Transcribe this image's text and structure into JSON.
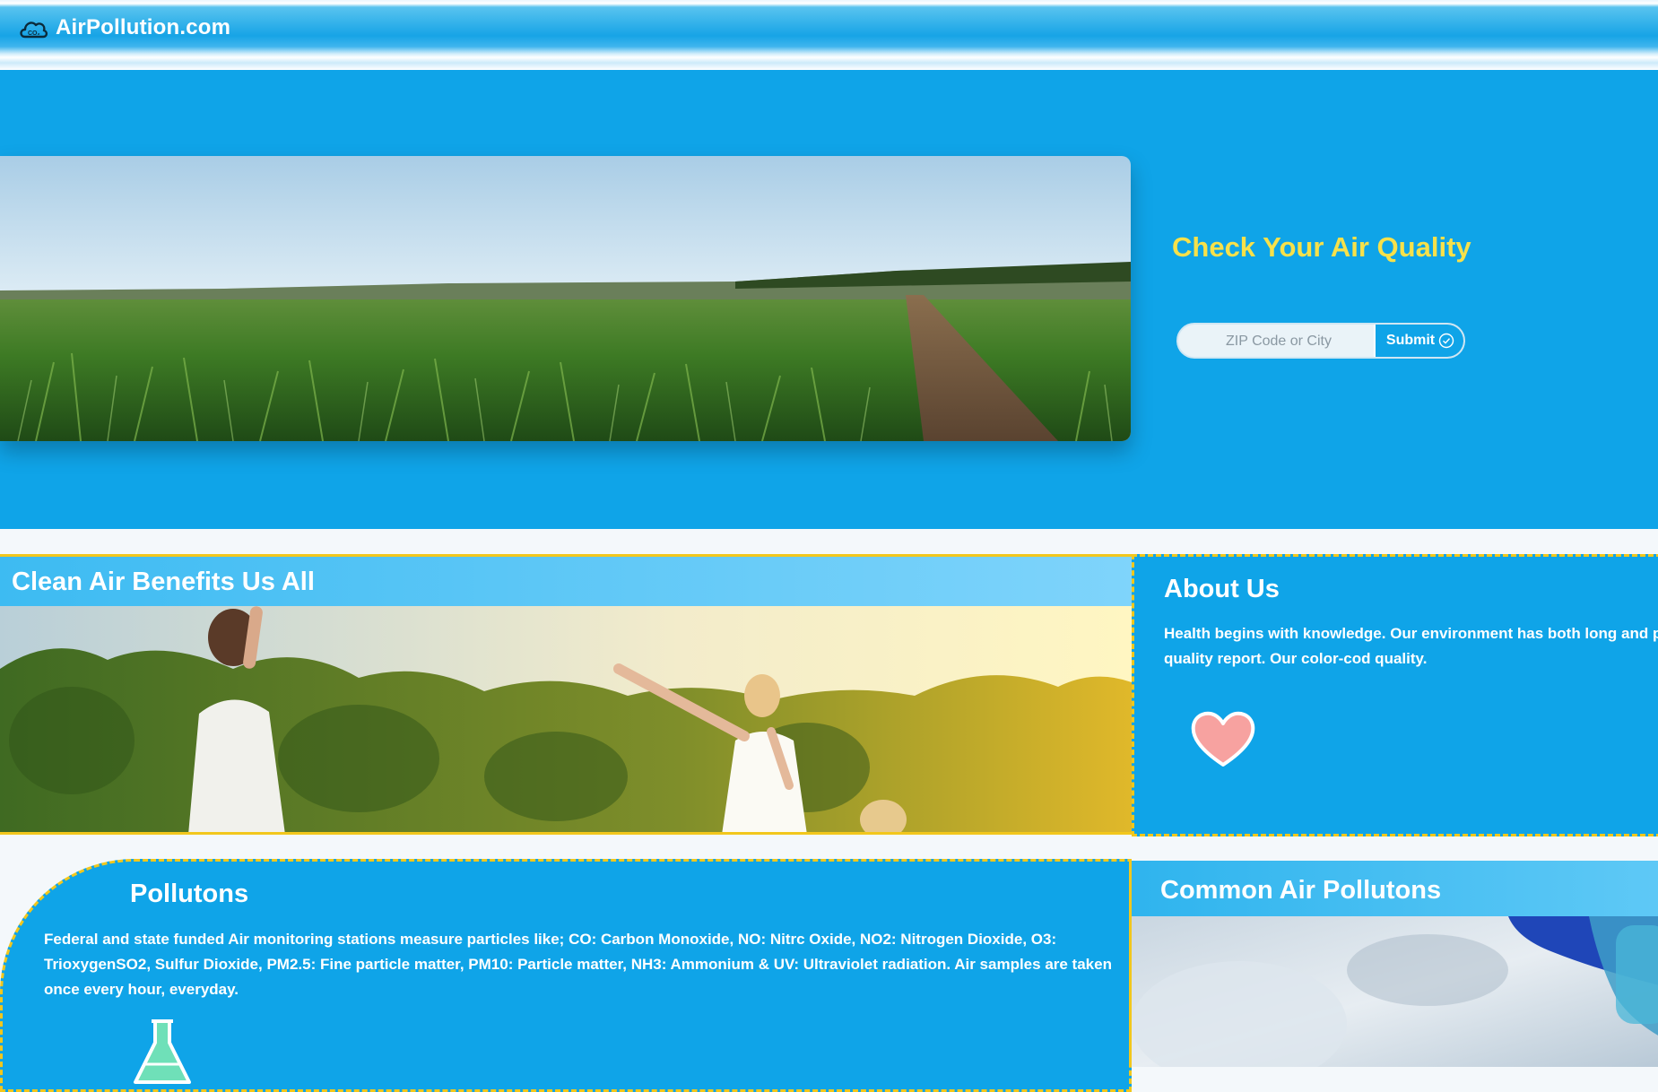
{
  "header": {
    "brand": "AirPollution.com",
    "logo_icon": "co2-cloud-icon"
  },
  "hero": {
    "title": "Check Your Air Quality",
    "search_placeholder": "ZIP Code or City",
    "submit_label": "Submit",
    "title_color": "#f7e14a",
    "background": "#0fa4e8"
  },
  "clean_air": {
    "title": "Clean Air Benefits Us All"
  },
  "about": {
    "title": "About Us",
    "text": "Health begins with knowledge. Our environment has both long and provide an instant and accurate live air quality report. Our color-cod quality.",
    "icon": "heart-icon"
  },
  "pollutants": {
    "title": "Pollutons",
    "text": "Federal and state funded Air monitoring stations measure particles like; CO: Carbon Monoxide, NO: Nitrc Oxide, NO2: Nitrogen Dioxide, O3: TrioxygenSO2, Sulfur Dioxide, PM2.5: Fine particle matter, PM10: Particle matter, NH3: Ammonium & UV: Ultraviolet radiation. Air samples are taken once every hour, everyday.",
    "icon": "flask-icon"
  },
  "common": {
    "title": "Common Air Pollutons"
  },
  "colors": {
    "accent_yellow": "#f2c71c",
    "primary_blue": "#0fa4e8"
  }
}
